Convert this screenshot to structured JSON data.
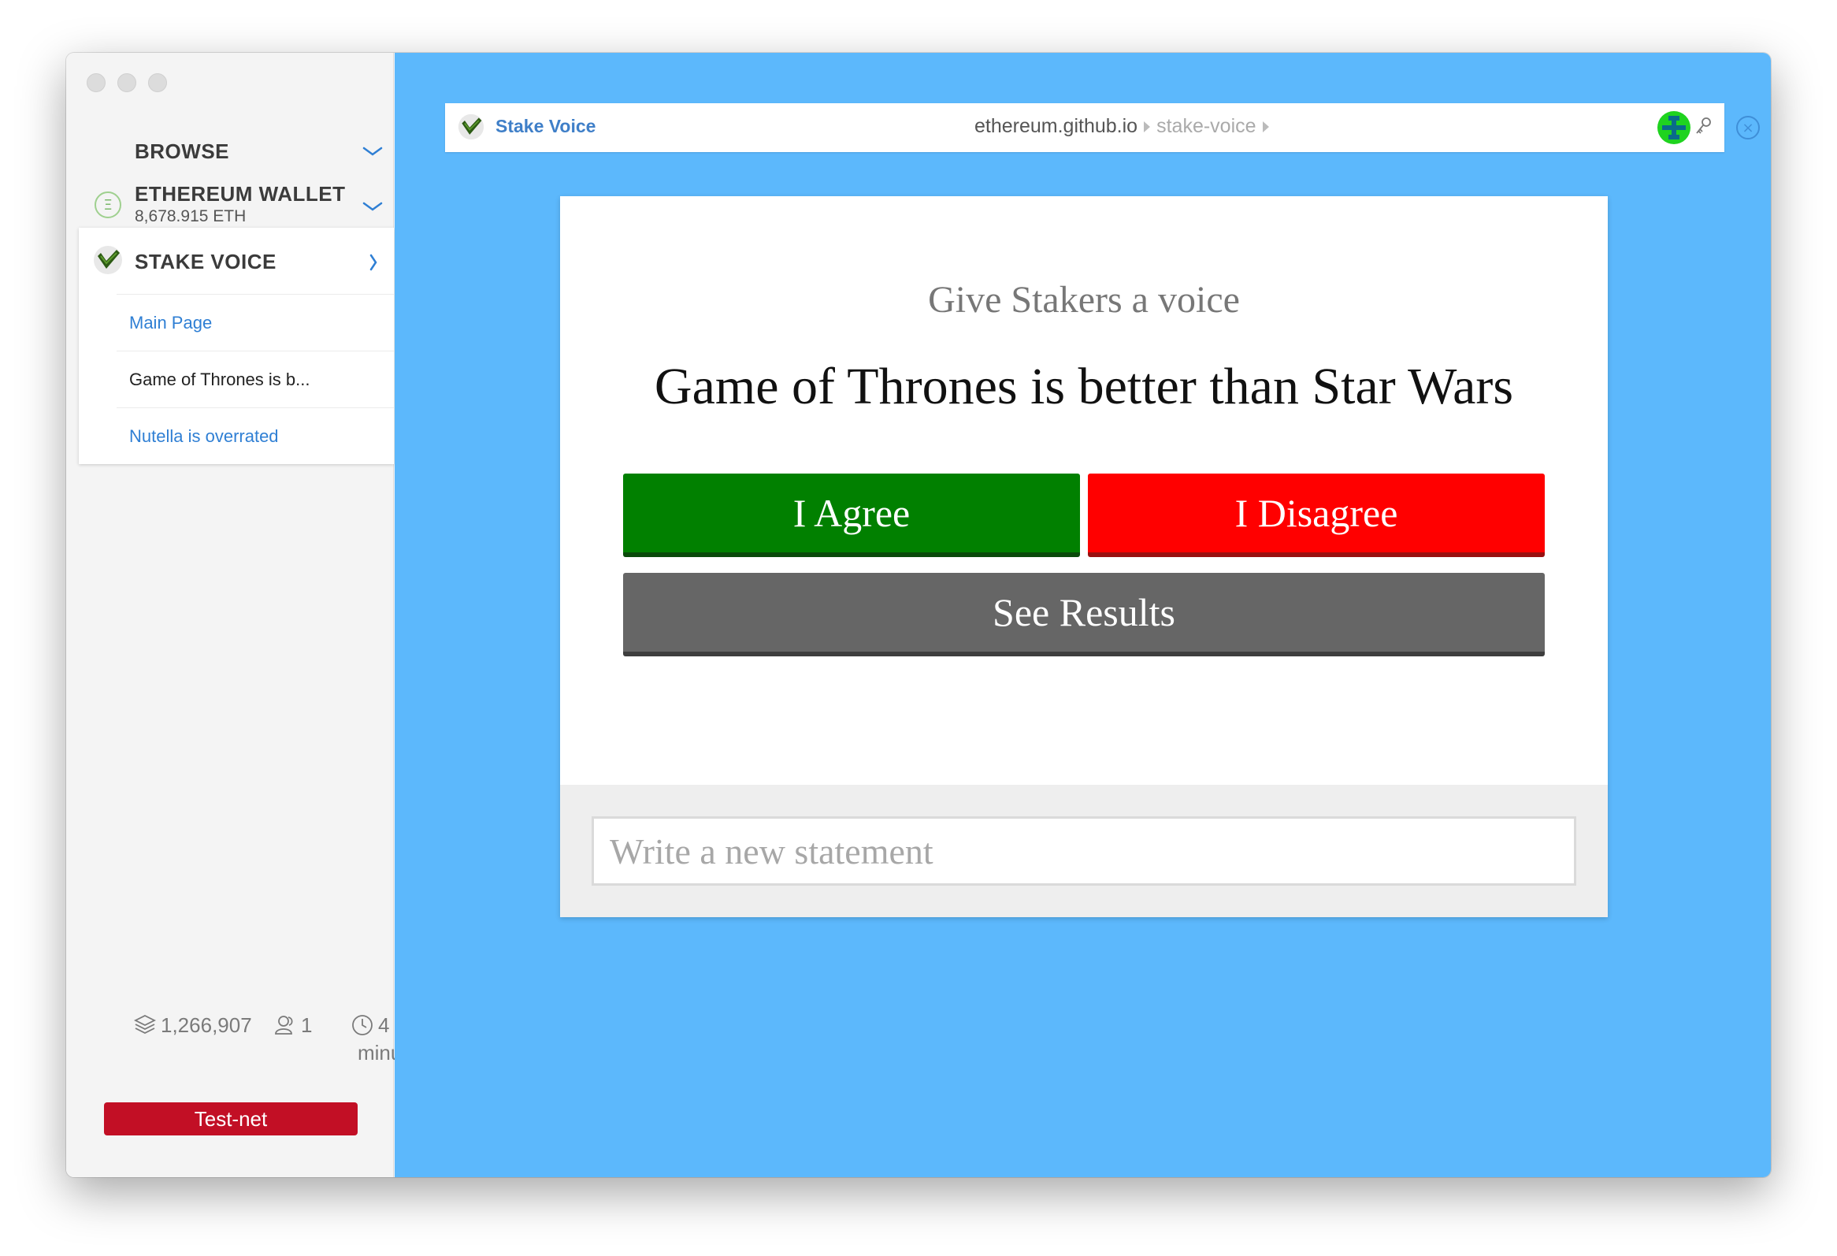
{
  "sidebar": {
    "browse_label": "BROWSE",
    "wallet": {
      "title": "ETHEREUM WALLET",
      "balance": "8,678.915 ETH",
      "icon": "ether-icon"
    },
    "dapp": {
      "title": "STAKE VOICE",
      "items": [
        {
          "label": "Main Page"
        },
        {
          "label": "Game of Thrones is b..."
        },
        {
          "label": "Nutella is overrated"
        }
      ]
    },
    "stats": {
      "blocks": "1,266,907",
      "peers": "1",
      "time_value": "4",
      "time_unit": "minutes"
    },
    "network_badge": "Test-net"
  },
  "urlbar": {
    "app_name": "Stake Voice",
    "domain": "ethereum.github.io",
    "path": "stake-voice"
  },
  "card": {
    "subtitle": "Give Stakers a voice",
    "statement": "Game of Thrones is better than Star Wars",
    "agree_label": "I Agree",
    "disagree_label": "I Disagree",
    "results_label": "See Results",
    "input_placeholder": "Write a new statement"
  },
  "colors": {
    "main_background": "#5cb8fc",
    "agree": "#018000",
    "disagree": "#ff0000",
    "results": "#666666",
    "testnet": "#c20f25",
    "link": "#2f7fd4"
  }
}
